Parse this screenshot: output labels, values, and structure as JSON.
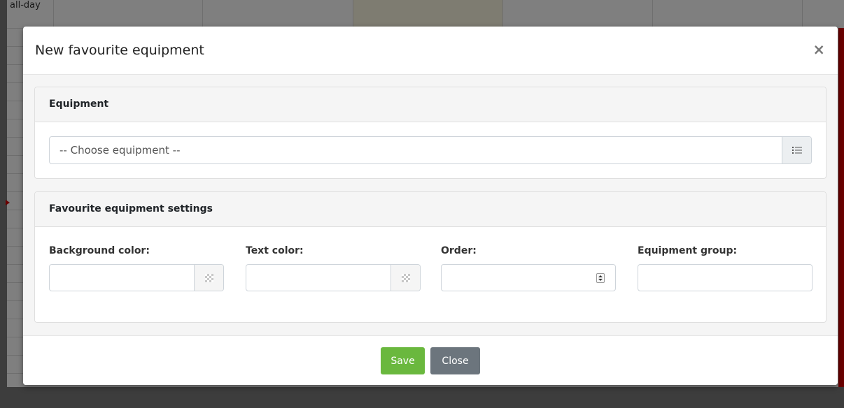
{
  "background": {
    "allday_label": "all-day"
  },
  "modal": {
    "title": "New favourite equipment",
    "close_glyph": "×",
    "equipment_section": {
      "heading": "Equipment",
      "select_placeholder": "-- Choose equipment --",
      "list_button_icon": "list-icon"
    },
    "settings_section": {
      "heading": "Favourite equipment settings",
      "fields": [
        {
          "label": "Background color:",
          "value": "",
          "type": "color"
        },
        {
          "label": "Text color:",
          "value": "",
          "type": "color"
        },
        {
          "label": "Order:",
          "value": "",
          "type": "number"
        },
        {
          "label": "Equipment group:",
          "value": "",
          "type": "text"
        }
      ]
    },
    "footer": {
      "save_label": "Save",
      "close_label": "Close"
    }
  },
  "colors": {
    "save": "#6ab83e",
    "close": "#6c757d",
    "now_indicator": "#d60000"
  }
}
